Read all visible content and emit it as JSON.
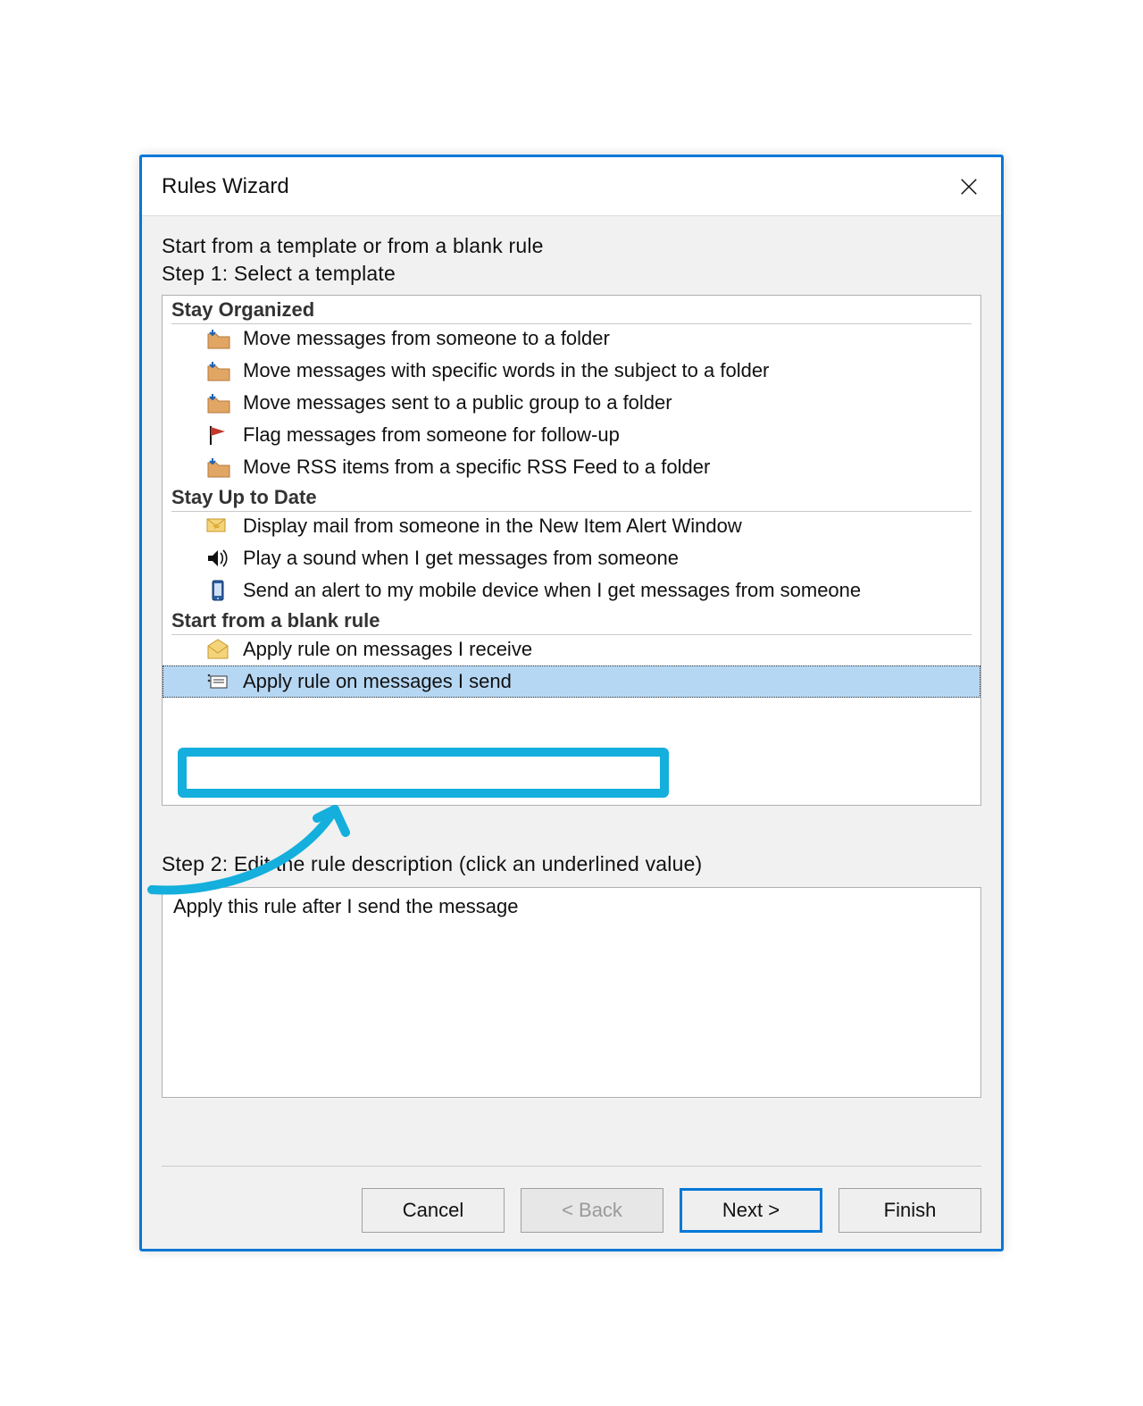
{
  "dialog": {
    "title": "Rules Wizard"
  },
  "instructions": {
    "intro": "Start from a template or from a blank rule",
    "step1": "Step 1: Select a template",
    "step2": "Step 2: Edit the rule description (click an underlined value)"
  },
  "groups": {
    "organized": "Stay Organized",
    "uptodate": "Stay Up to Date",
    "blank": "Start from a blank rule"
  },
  "templates": {
    "organized": [
      "Move messages from someone to a folder",
      "Move messages with specific words in the subject to a folder",
      "Move messages sent to a public group to a folder",
      "Flag messages from someone for follow-up",
      "Move RSS items from a specific RSS Feed to a folder"
    ],
    "uptodate": [
      "Display mail from someone in the New Item Alert Window",
      "Play a sound when I get messages from someone",
      "Send an alert to my mobile device when I get messages from someone"
    ],
    "blank": [
      "Apply rule on messages I receive",
      "Apply rule on messages I send"
    ]
  },
  "description": {
    "text": "Apply this rule after I send the message"
  },
  "buttons": {
    "cancel": "Cancel",
    "back": "< Back",
    "next": "Next >",
    "finish": "Finish"
  }
}
